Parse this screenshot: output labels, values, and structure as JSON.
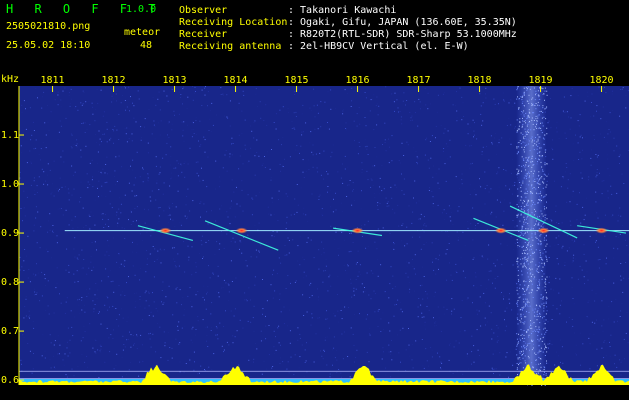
{
  "header": {
    "app_title": "H R O F F T",
    "app_version": "1.0.0",
    "file_name": "2505021810.png",
    "timestamp": "25.05.02 18:10",
    "meteor_label": "meteor",
    "meteor_count": "48",
    "info": [
      {
        "key": "Observer",
        "value": ": Takanori Kawachi"
      },
      {
        "key": "Receiving Location",
        "value": ": Ogaki, Gifu, JAPAN (136.60E, 35.35N)"
      },
      {
        "key": "Receiver",
        "value": ": R820T2(RTL-SDR) SDR-Sharp 53.1000MHz"
      },
      {
        "key": "Receiving antenna",
        "value": ": 2el-HB9CV Vertical (el. E-W)"
      }
    ]
  },
  "colors": {
    "background": "#000000",
    "label_green": "#00ff00",
    "label_yellow": "#ffff00",
    "spectrum_blue": "#1a2a8c",
    "signal_red": "#ff3030",
    "signal_cyan": "#40ffe0"
  },
  "chart_data": {
    "type": "heatmap",
    "y_unit_label": "kHz",
    "x_tick_labels": [
      "1811",
      "1812",
      "1813",
      "1814",
      "1815",
      "1816",
      "1817",
      "1818",
      "1819",
      "1820"
    ],
    "x_ticks": [
      1811,
      1812,
      1813,
      1814,
      1815,
      1816,
      1817,
      1818,
      1819,
      1820
    ],
    "x_range": [
      1810.45,
      1820.45
    ],
    "y_tick_labels": [
      "1.1",
      "1.0",
      "0.9",
      "0.8",
      "0.7",
      "0.6"
    ],
    "y_ticks": [
      1.1,
      1.0,
      0.9,
      0.8,
      0.7,
      0.6
    ],
    "y_range": [
      0.59,
      1.2
    ],
    "carrier_freq_khz": 0.905,
    "meteor_echoes": [
      {
        "t_start": 1812.4,
        "t_end": 1813.3,
        "f_start": 0.915,
        "f_end": 0.885
      },
      {
        "t_start": 1813.5,
        "t_end": 1814.7,
        "f_start": 0.925,
        "f_end": 0.865
      },
      {
        "t_start": 1815.6,
        "t_end": 1816.4,
        "f_start": 0.91,
        "f_end": 0.895
      },
      {
        "t_start": 1817.9,
        "t_end": 1818.8,
        "f_start": 0.93,
        "f_end": 0.885
      },
      {
        "t_start": 1818.5,
        "t_end": 1819.6,
        "f_start": 0.955,
        "f_end": 0.89
      },
      {
        "t_start": 1819.6,
        "t_end": 1820.4,
        "f_start": 0.915,
        "f_end": 0.9
      }
    ],
    "noise_band": {
      "t_start": 1818.6,
      "t_end": 1819.1
    },
    "level_peaks": [
      1812.7,
      1814.0,
      1816.1,
      1818.8,
      1819.3,
      1820.0
    ]
  }
}
